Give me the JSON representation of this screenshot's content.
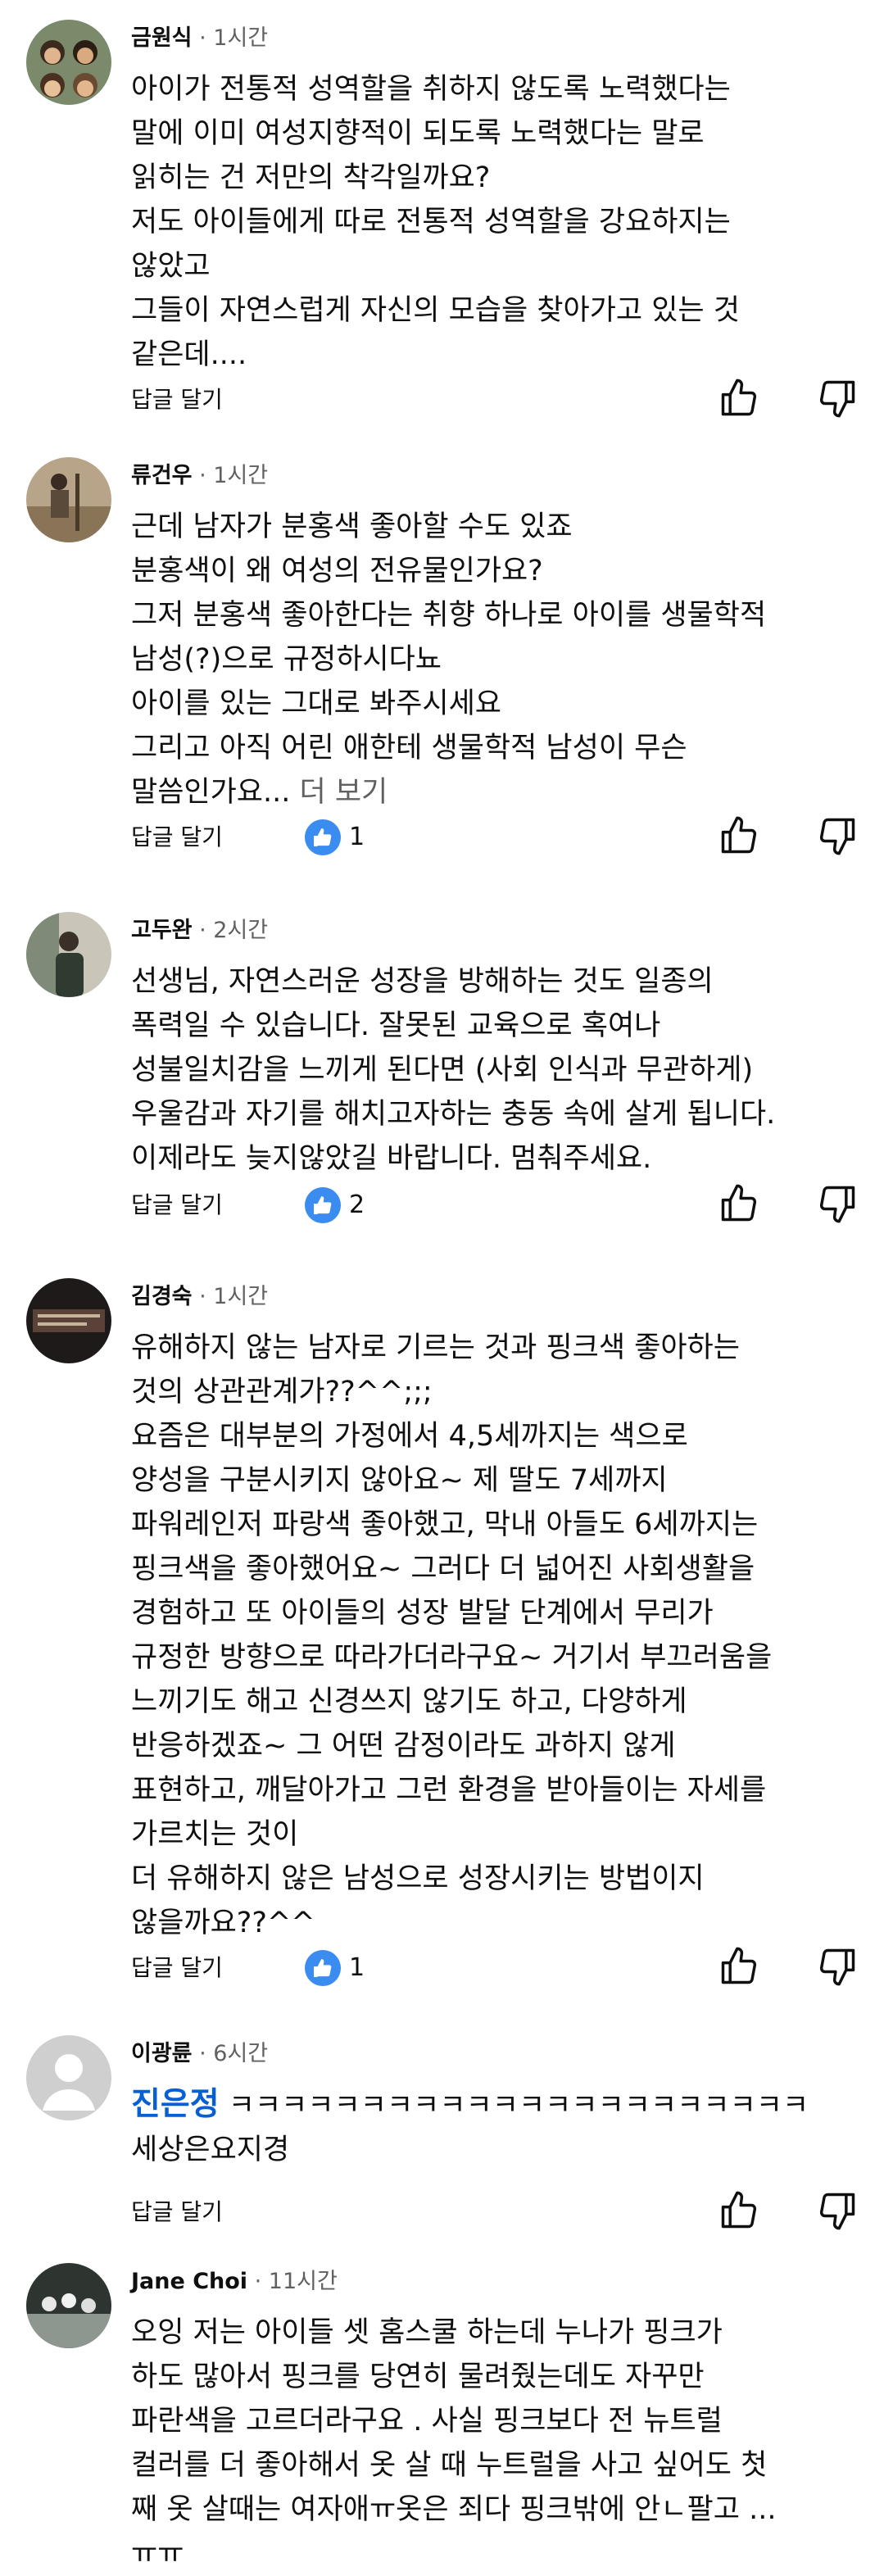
{
  "colors": {
    "text": "#0f0f0f",
    "meta": "#606060",
    "mention": "#065fd4",
    "badge": "#3b8cf0"
  },
  "icons": {
    "like": "thumb-up-outline-icon",
    "dislike": "thumb-down-outline-icon",
    "creator_heart_badge": "thumb-up-filled-badge-icon",
    "default_avatar": "person-icon"
  },
  "comments": [
    {
      "author": "금원식",
      "time": "· 1시간",
      "lines": [
        "아이가 전통적 성역할을 취하지 않도록 노력했다는",
        "말에 이미 여성지향적이 되도록 노력했다는 말로",
        "읽히는 건 저만의 착각일까요?",
        "저도 아이들에게 따로 전통적 성역할을 강요하지는",
        "않았고",
        "그들이 자연스럽게 자신의 모습을 찾아가고 있는 것",
        "같은데...."
      ],
      "reply_label": "답글 달기"
    },
    {
      "author": "류건우",
      "time": "· 1시간",
      "lines": [
        "근데 남자가 분홍색 좋아할 수도 있죠",
        "분홍색이 왜 여성의 전유물인가요?",
        "그저 분홍색 좋아한다는 취향 하나로 아이를 생물학적",
        "남성(?)으로 규정하시다뇨",
        "아이를 있는 그대로 봐주시세요",
        "그리고 아직 어린 애한테 생물학적 남성이 무슨",
        "말씀인가요..."
      ],
      "more_label": "더 보기",
      "reply_label": "답글 달기",
      "badge_count": "1"
    },
    {
      "author": "고두완",
      "time": "· 2시간",
      "lines": [
        "선생님, 자연스러운 성장을 방해하는 것도 일종의",
        "폭력일 수 있습니다. 잘못된 교육으로 혹여나",
        "성불일치감을 느끼게 된다면 (사회 인식과 무관하게)",
        "우울감과 자기를 해치고자하는 충동 속에 살게 됩니다.",
        "이제라도 늦지않았길 바랍니다. 멈춰주세요."
      ],
      "reply_label": "답글 달기",
      "badge_count": "2"
    },
    {
      "author": "김경숙",
      "time": "· 1시간",
      "lines": [
        "유해하지 않는 남자로 기르는 것과 핑크색 좋아하는",
        "것의 상관관계가??^^;;;",
        "요즘은 대부분의 가정에서  4,5세까지는 색으로",
        "양성을 구분시키지 않아요~ 제 딸도 7세까지",
        "파워레인저 파랑색 좋아했고, 막내 아들도 6세까지는",
        "핑크색을 좋아했어요~ 그러다 더 넓어진 사회생활을",
        "경험하고 또 아이들의 성장 발달 단계에서  무리가",
        "규정한 방향으로 따라가더라구요~ 거기서 부끄러움을",
        "느끼기도 해고 신경쓰지 않기도 하고, 다양하게",
        "반응하겠죠~ 그 어떤 감정이라도 과하지 않게",
        "표현하고, 깨달아가고 그런 환경을 받아들이는 자세를",
        "가르치는 것이",
        "더 유해하지 않은 남성으로 성장시키는 방법이지",
        "않을까요??^^"
      ],
      "reply_label": "답글 달기",
      "badge_count": "1"
    },
    {
      "author": "이광륜",
      "time": "· 6시간",
      "mention": "진은정",
      "mention_rest": " ㅋㅋㅋㅋㅋㅋㅋㅋㅋㅋㅋㅋㅋㅋㅋㅋㅋㅋㅋㅋㅋㅋ",
      "lines": [
        "세상은요지경"
      ],
      "reply_label": "답글 달기"
    },
    {
      "author": "Jane Choi",
      "time": "· 11시간",
      "lines": [
        "오잉 저는 아이들 셋 홈스쿨 하는데 누나가 핑크가",
        "하도 많아서 핑크를 당연히 물려줬는데도 자꾸만",
        "파란색을 고르더라구요 . 사실 핑크보다 전 뉴트럴",
        "컬러를 더 좋아해서 옷 살 때 누트럴을 사고 싶어도 첫",
        "째 옷 살때는 여자애ㅠ옷은 죄다 핑크밖에 안ㄴ팔고 ...",
        "ㅠㅠ"
      ]
    }
  ]
}
